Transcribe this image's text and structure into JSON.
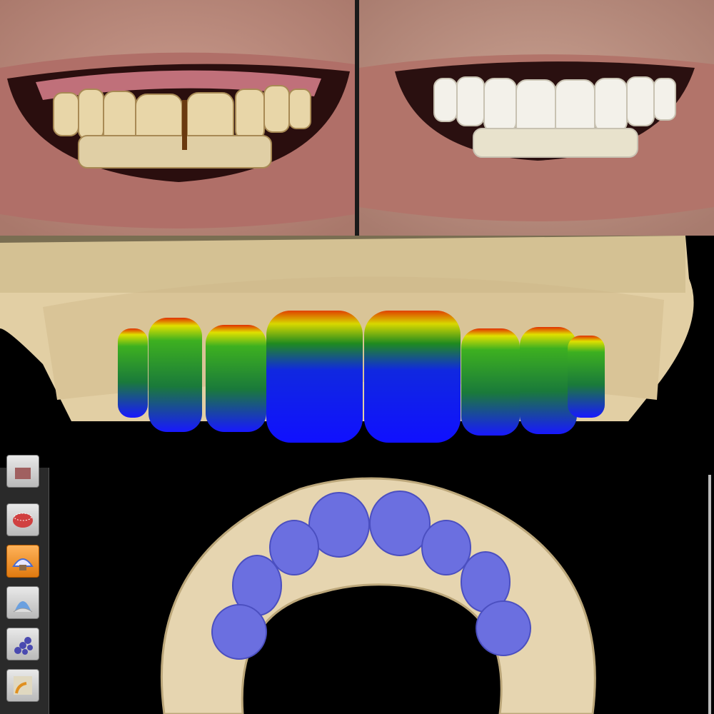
{
  "photos": {
    "before": {
      "icon": "smile-before-photo"
    },
    "after": {
      "icon": "smile-after-photo"
    }
  },
  "views": {
    "front": {
      "icon": "front-3d-veneer-heatmap",
      "heatmap_colors": [
        "#1a1aff",
        "#1f8a1f",
        "#d8d800",
        "#e04000"
      ]
    },
    "occlusal": {
      "icon": "occlusal-3d-arch",
      "model_color": "#e6d5b0",
      "restoration_color": "#6b6fe0"
    }
  },
  "toolbar": {
    "items": [
      {
        "icon": "model-icon",
        "active": false
      },
      {
        "icon": "margin-icon",
        "active": false
      },
      {
        "icon": "restoration-design-icon",
        "active": true
      },
      {
        "icon": "shape-icon",
        "active": false
      },
      {
        "icon": "tooth-library-icon",
        "active": false
      },
      {
        "icon": "connector-icon",
        "active": false
      }
    ]
  }
}
